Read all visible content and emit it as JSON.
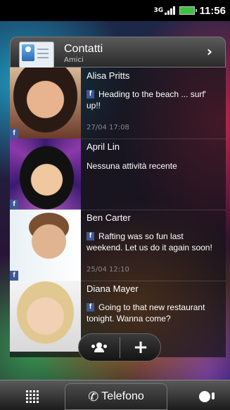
{
  "status_bar": {
    "network": "3G",
    "time": "11:56"
  },
  "widget": {
    "title": "Contatti",
    "subtitle": "Amici",
    "contacts": [
      {
        "name": "Alisa Pritts",
        "status": "Heading to the beach ... surf' up!!",
        "time": "27/04 17:08",
        "source": "f"
      },
      {
        "name": "April Lin",
        "status": "Nessuna attività recente",
        "time": "",
        "source": "f"
      },
      {
        "name": "Ben Carter",
        "status": "Rafting was so fun last weekend. Let us do it again soon!",
        "time": "25/04 12:10",
        "source": "f"
      },
      {
        "name": "Diana Mayer",
        "status": "Going to that new restaurant tonight. Wanna come?",
        "time": "",
        "source": "f"
      }
    ],
    "actions": {
      "add_label": "+"
    }
  },
  "dock": {
    "phone_label": "Telefono"
  },
  "icons": {
    "contacts": "contacts-card-icon",
    "chevron": "chevron-right-icon",
    "groups": "people-group-icon",
    "apps": "app-grid-icon",
    "phone": "phone-handset-icon",
    "personalize": "personalize-brush-icon"
  },
  "colors": {
    "facebook": "#3b5998",
    "battery": "#3ec13e"
  }
}
